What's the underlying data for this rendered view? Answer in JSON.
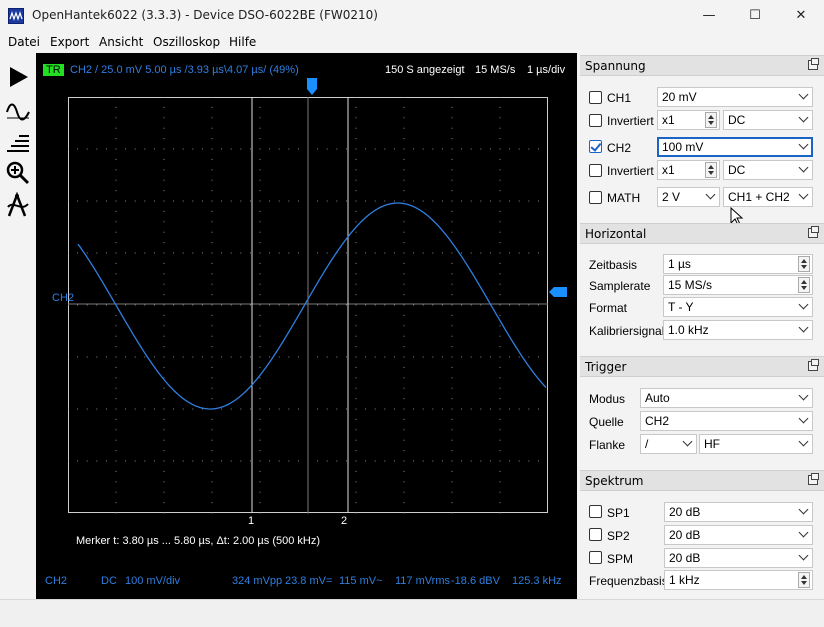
{
  "window": {
    "title": "OpenHantek6022 (3.3.3) - Device DSO-6022BE (FW0210)",
    "minimize_symbol": "—",
    "maximize_symbol": "☐",
    "close_symbol": "✕"
  },
  "menu": [
    "Datei",
    "Export",
    "Ansicht",
    "Oszilloskop",
    "Hilfe"
  ],
  "toolbar": {
    "icons": [
      "play-icon",
      "waveform-icon",
      "cursor-lines-icon",
      "zoom-icon",
      "measure-icon"
    ]
  },
  "scope": {
    "trigger_badge": "TR",
    "header_info": "CH2  /  25.0 mV  5.00 µs /3.93 µs\\4.07 µs/ (49%)",
    "samples_shown": "150 S angezeigt",
    "sample_rate": "15 MS/s",
    "timebase": "1 µs/div",
    "channel_marker": "CH2",
    "marker1": "1",
    "marker2": "2",
    "marker_info": "Merker   t: 3.80 µs ... 5.80 µs,  Δt: 2.00 µs (500 kHz)",
    "footer": {
      "channel": "CH2",
      "coupling": "DC",
      "vdiv": "100 mV/div",
      "vpp": "324 mVpp",
      "vdc": "23.8 mV=",
      "vac": "115 mV~",
      "vrms": "117 mVrms",
      "dbv": "-18.6 dBV",
      "freq": "125.3 kHz"
    },
    "colors": {
      "background": "#000000",
      "grid": "#8a8a8a",
      "trace": "#2f7fe0",
      "trigger": "#1a8fff",
      "badge": "#21e021"
    }
  },
  "spannung": {
    "title": "Spannung",
    "ch1": {
      "label": "CH1",
      "checked": false,
      "value": "20 mV"
    },
    "ch1_inv": {
      "label": "Invertiert",
      "checked": false,
      "probe": "x1",
      "coupling": "DC"
    },
    "ch2": {
      "label": "CH2",
      "checked": true,
      "value": "100 mV"
    },
    "ch2_inv": {
      "label": "Invertiert",
      "checked": false,
      "probe": "x1",
      "coupling": "DC"
    },
    "math": {
      "label": "MATH",
      "checked": false,
      "value": "2 V",
      "mode": "CH1 + CH2"
    }
  },
  "horizontal": {
    "title": "Horizontal",
    "zeitbasis": {
      "label": "Zeitbasis",
      "value": "1 µs"
    },
    "samplerate": {
      "label": "Samplerate",
      "value": "15 MS/s"
    },
    "format": {
      "label": "Format",
      "value": "T - Y"
    },
    "kalibrier": {
      "label": "Kalibriersignal",
      "value": "1.0 kHz"
    }
  },
  "trigger": {
    "title": "Trigger",
    "modus": {
      "label": "Modus",
      "value": "Auto"
    },
    "quelle": {
      "label": "Quelle",
      "value": "CH2"
    },
    "flanke": {
      "label": "Flanke",
      "value": "/",
      "filter": "HF"
    }
  },
  "spektrum": {
    "title": "Spektrum",
    "sp1": {
      "label": "SP1",
      "checked": false,
      "value": "20 dB"
    },
    "sp2": {
      "label": "SP2",
      "checked": false,
      "value": "20 dB"
    },
    "spm": {
      "label": "SPM",
      "checked": false,
      "value": "20 dB"
    },
    "frequenzbasis": {
      "label": "Frequenzbasis",
      "value": "1 kHz"
    }
  }
}
